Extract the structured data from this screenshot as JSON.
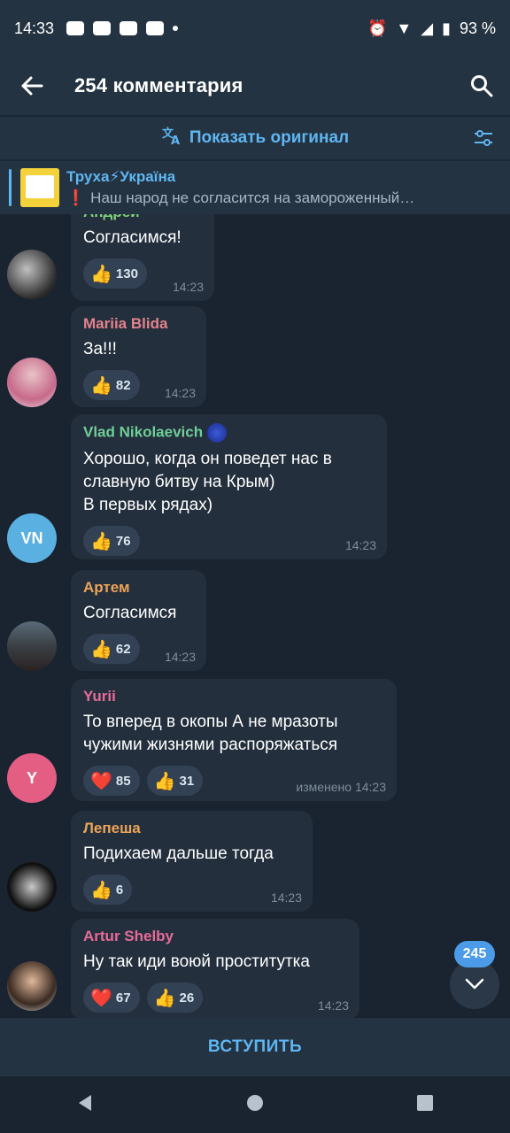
{
  "status": {
    "time": "14:33",
    "battery": "93 %"
  },
  "header": {
    "title": "254 комментария"
  },
  "translate": {
    "label": "Показать оригинал"
  },
  "pinned": {
    "channel": "Труха⚡Україна",
    "text": "Наш народ не согласится на замороженный…"
  },
  "messages": [
    {
      "name": "Андрей",
      "text": "Согласимся!",
      "reactions": [
        {
          "emoji": "👍",
          "count": "130"
        }
      ],
      "time": "14:23"
    },
    {
      "name": "Mariia Blida",
      "text": "За!!!",
      "reactions": [
        {
          "emoji": "👍",
          "count": "82"
        }
      ],
      "time": "14:23"
    },
    {
      "name": "Vlad Nikolaevich",
      "avatar": "VN",
      "text": "Хорошо, когда он поведет нас в\nславную  битву на Крым)\nВ первых рядах)",
      "reactions": [
        {
          "emoji": "👍",
          "count": "76"
        }
      ],
      "time": "14:23"
    },
    {
      "name": "Артем",
      "text": "Согласимся",
      "reactions": [
        {
          "emoji": "👍",
          "count": "62"
        }
      ],
      "time": "14:23"
    },
    {
      "name": "Yurii",
      "avatar": "Y",
      "text": "То вперед в окопы А не мразоты\nчужими жизнями распоряжаться",
      "reactions": [
        {
          "emoji": "❤️",
          "count": "85"
        },
        {
          "emoji": "👍",
          "count": "31"
        }
      ],
      "time": "изменено 14:23"
    },
    {
      "name": "Лепеша",
      "text": "Подихаем дальше тогда",
      "reactions": [
        {
          "emoji": "👍",
          "count": "6"
        }
      ],
      "time": "14:23"
    },
    {
      "name": "Artur Shelby",
      "text": "Ну так иди воюй проститутка",
      "reactions": [
        {
          "emoji": "❤️",
          "count": "67"
        },
        {
          "emoji": "👍",
          "count": "26"
        }
      ],
      "time": "14:23"
    }
  ],
  "scroll_badge": "245",
  "join_button": "ВСТУПИТЬ",
  "colors": {
    "accent": "#5fb6f2",
    "bubble": "#242f3d",
    "background": "#192430"
  }
}
